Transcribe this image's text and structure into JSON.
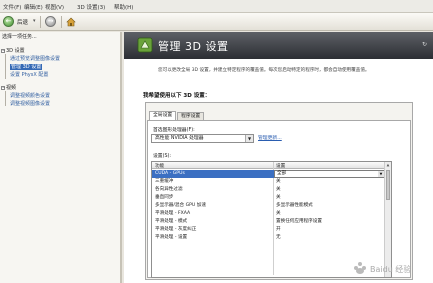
{
  "menu": [
    "文件(F)",
    "编辑(E)",
    "视图(V)",
    "3D 设置(3)",
    "帮助(H)"
  ],
  "toolbar": {
    "back_label": "后退",
    "back_dropdown": "▾"
  },
  "left_pane": {
    "title": "选择一项任务...",
    "tree": [
      {
        "label": "3D 设置",
        "level": 0
      },
      {
        "label": "通过预览调整图像设置",
        "level": 1
      },
      {
        "label": "管理 3D 设置",
        "level": 1,
        "selected": true
      },
      {
        "label": "设置 PhysX 配置",
        "level": 1
      },
      {
        "label": "视频",
        "level": 0
      },
      {
        "label": "调整视频颜色设置",
        "level": 1
      },
      {
        "label": "调整视频图像设置",
        "level": 1
      }
    ]
  },
  "header": {
    "title": "管理 3D 设置",
    "restore": "↻"
  },
  "description": "您可以更改全局 3D 设置，并建立特定程序的覆盖值。每次您启动特定的程序时，都会自动使用覆盖值。",
  "section_label": "我希望使用以下 3D 设置：",
  "tabs": [
    "全局设置",
    "程序设置"
  ],
  "gpu": {
    "label": "首选图形处理器(F):",
    "value": "高性能 NVIDIA 处理器",
    "link": "管理更新..."
  },
  "settings_label": "设置(S):",
  "grid": {
    "headers": [
      "功能",
      "设置"
    ],
    "rows": [
      {
        "feature": "CUDA - GPUs",
        "setting": "全部",
        "selected": true
      },
      {
        "feature": "三重缓冲",
        "setting": "关"
      },
      {
        "feature": "各向异性过滤",
        "setting": "关"
      },
      {
        "feature": "垂直同步",
        "setting": "关"
      },
      {
        "feature": "多显示器/混合 GPU 加速",
        "setting": "多显示器性能模式"
      },
      {
        "feature": "平滑处理 - FXAA",
        "setting": "关"
      },
      {
        "feature": "平滑处理 - 模式",
        "setting": "置换任何应用程序设置"
      },
      {
        "feature": "平滑处理 - 灰度纠正",
        "setting": "开"
      },
      {
        "feature": "平滑处理 - 设置",
        "setting": "无"
      }
    ]
  },
  "watermark": "Baidu 经验"
}
